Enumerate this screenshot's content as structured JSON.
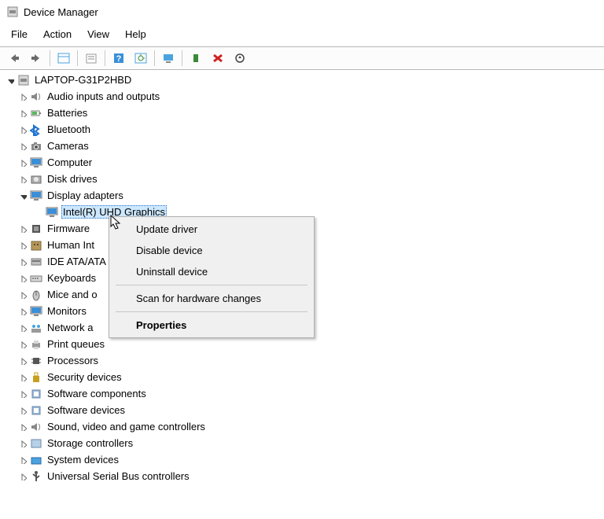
{
  "window": {
    "title": "Device Manager"
  },
  "menubar": [
    "File",
    "Action",
    "View",
    "Help"
  ],
  "tree": {
    "root": "LAPTOP-G31P2HBD",
    "categories": [
      {
        "label": "Audio inputs and outputs",
        "icon": "speaker"
      },
      {
        "label": "Batteries",
        "icon": "battery"
      },
      {
        "label": "Bluetooth",
        "icon": "bluetooth"
      },
      {
        "label": "Cameras",
        "icon": "camera"
      },
      {
        "label": "Computer",
        "icon": "monitor"
      },
      {
        "label": "Disk drives",
        "icon": "disk"
      },
      {
        "label": "Display adapters",
        "icon": "monitor",
        "expanded": true,
        "children": [
          {
            "label": "Intel(R) UHD Graphics",
            "icon": "monitor",
            "selected": true
          }
        ]
      },
      {
        "label": "Firmware",
        "icon": "chip"
      },
      {
        "label": "Human Int",
        "icon": "hid",
        "truncated": true
      },
      {
        "label": "IDE ATA/ATA",
        "icon": "ide",
        "truncated": true
      },
      {
        "label": "Keyboards",
        "icon": "keyboard",
        "truncated": true
      },
      {
        "label": "Mice and o",
        "icon": "mouse",
        "truncated": true
      },
      {
        "label": "Monitors",
        "icon": "monitor"
      },
      {
        "label": "Network a",
        "icon": "network",
        "truncated": true
      },
      {
        "label": "Print queues",
        "icon": "printer"
      },
      {
        "label": "Processors",
        "icon": "cpu"
      },
      {
        "label": "Security devices",
        "icon": "security"
      },
      {
        "label": "Software components",
        "icon": "software"
      },
      {
        "label": "Software devices",
        "icon": "software"
      },
      {
        "label": "Sound, video and game controllers",
        "icon": "speaker"
      },
      {
        "label": "Storage controllers",
        "icon": "storage"
      },
      {
        "label": "System devices",
        "icon": "system"
      },
      {
        "label": "Universal Serial Bus controllers",
        "icon": "usb"
      }
    ]
  },
  "context_menu": {
    "update": "Update driver",
    "disable": "Disable device",
    "uninstall": "Uninstall device",
    "scan": "Scan for hardware changes",
    "properties": "Properties"
  }
}
